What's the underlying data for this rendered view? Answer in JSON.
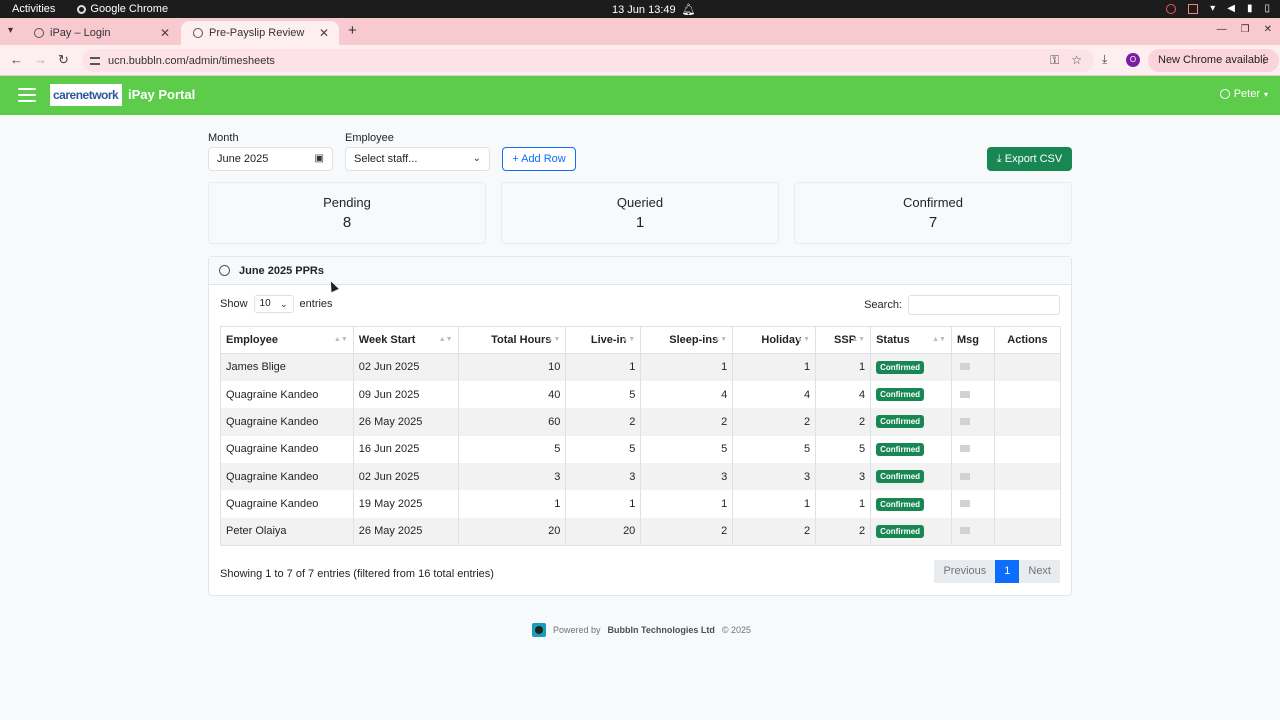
{
  "os": {
    "activities": "Activities",
    "app_name": "Google Chrome",
    "datetime": "13 Jun  13:49"
  },
  "browser": {
    "tabs": [
      {
        "title": "iPay – Login",
        "active": false
      },
      {
        "title": "Pre-Payslip Review",
        "active": true
      }
    ],
    "url": "ucn.bubbln.com/admin/timesheets",
    "profile_initial": "O",
    "update_button": "New Chrome available"
  },
  "appnav": {
    "logo_text": "carenetwork",
    "brand": "iPay Portal",
    "user": "Peter"
  },
  "filters": {
    "month_label": "Month",
    "month_value": "June 2025",
    "employee_label": "Employee",
    "employee_placeholder": "Select staff...",
    "add_row": "+ Add Row",
    "export_csv": "Export CSV"
  },
  "summary": [
    {
      "title": "Pending",
      "value": "8"
    },
    {
      "title": "Queried",
      "value": "1"
    },
    {
      "title": "Confirmed",
      "value": "7"
    }
  ],
  "panel": {
    "title": "June 2025 PPRs",
    "show_label": "Show",
    "page_size": "10",
    "entries_label": "entries",
    "search_label": "Search:",
    "columns": [
      "Employee",
      "Week Start",
      "Total Hours",
      "Live-in",
      "Sleep-ins",
      "Holiday",
      "SSP",
      "Status",
      "Msg",
      "Actions"
    ],
    "rows": [
      {
        "employee": "James Blige",
        "week_start": "02 Jun 2025",
        "total_hours": "10",
        "live_in": "1",
        "sleep_ins": "1",
        "holiday": "1",
        "ssp": "1",
        "status": "Confirmed"
      },
      {
        "employee": "Quagraine Kandeo",
        "week_start": "09 Jun 2025",
        "total_hours": "40",
        "live_in": "5",
        "sleep_ins": "4",
        "holiday": "4",
        "ssp": "4",
        "status": "Confirmed"
      },
      {
        "employee": "Quagraine Kandeo",
        "week_start": "26 May 2025",
        "total_hours": "60",
        "live_in": "2",
        "sleep_ins": "2",
        "holiday": "2",
        "ssp": "2",
        "status": "Confirmed"
      },
      {
        "employee": "Quagraine Kandeo",
        "week_start": "16 Jun 2025",
        "total_hours": "5",
        "live_in": "5",
        "sleep_ins": "5",
        "holiday": "5",
        "ssp": "5",
        "status": "Confirmed"
      },
      {
        "employee": "Quagraine Kandeo",
        "week_start": "02 Jun 2025",
        "total_hours": "3",
        "live_in": "3",
        "sleep_ins": "3",
        "holiday": "3",
        "ssp": "3",
        "status": "Confirmed"
      },
      {
        "employee": "Quagraine Kandeo",
        "week_start": "19 May 2025",
        "total_hours": "1",
        "live_in": "1",
        "sleep_ins": "1",
        "holiday": "1",
        "ssp": "1",
        "status": "Confirmed"
      },
      {
        "employee": "Peter Olaiya",
        "week_start": "26 May 2025",
        "total_hours": "20",
        "live_in": "20",
        "sleep_ins": "2",
        "holiday": "2",
        "ssp": "2",
        "status": "Confirmed"
      }
    ],
    "info": "Showing 1 to 7 of 7 entries (filtered from 16 total entries)",
    "pager": {
      "previous": "Previous",
      "current": "1",
      "next": "Next"
    }
  },
  "footer": {
    "prefix": "Powered by",
    "company": "Bubbln Technologies Ltd",
    "suffix": "© 2025"
  },
  "colors": {
    "navbar": "#5ccc4a",
    "primary": "#0d6efd",
    "success": "#198754"
  }
}
